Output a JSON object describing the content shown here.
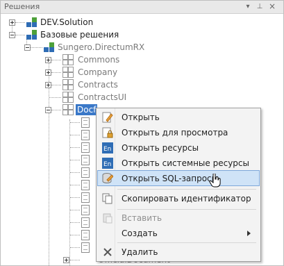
{
  "panel": {
    "title": "Решения"
  },
  "tree": {
    "dev_solution": "DEV.Solution",
    "base_solutions": "Базовые решения",
    "sungero": "Sungero.DirectumRX",
    "modules": [
      "Commons",
      "Company",
      "Contracts",
      "ContractsUI"
    ],
    "selected_partial": "Docf",
    "partial_bottom": "OfficialDocument"
  },
  "menu": {
    "items": [
      {
        "label": "Открыть",
        "icon": "edit-pencil-icon"
      },
      {
        "label": "Открыть для просмотра",
        "icon": "view-lock-icon"
      },
      {
        "label": "Открыть ресурсы",
        "icon": "resources-en-icon"
      },
      {
        "label": "Открыть системные ресурсы",
        "icon": "system-resources-en-icon"
      },
      {
        "label": "Открыть SQL-запросы",
        "icon": "sql-database-icon",
        "highlighted": true
      },
      {
        "label": "Скопировать идентификатор",
        "icon": "copy-icon"
      },
      {
        "label": "Вставить",
        "icon": "paste-icon",
        "disabled": true
      },
      {
        "label": "Создать",
        "submenu": true
      },
      {
        "label": "Удалить",
        "icon": "delete-x-icon"
      }
    ]
  },
  "colors": {
    "selection": "#3a78c8",
    "menu_highlight": "#cfe3f7",
    "menu_highlight_border": "#7da7d9"
  }
}
